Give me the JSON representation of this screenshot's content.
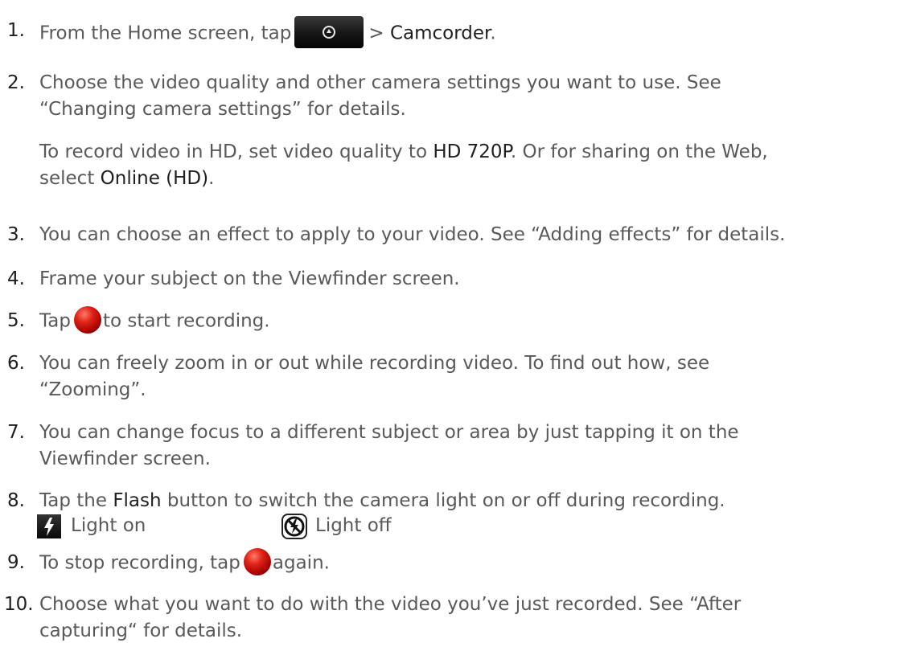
{
  "steps": [
    {
      "num": "1.",
      "parts": [
        "From the Home screen, tap",
        "> ",
        "Camcorder",
        "."
      ]
    },
    {
      "num": "2.",
      "lines": [
        "Choose the video quality and other camera settings you want to use. See",
        "“Changing camera settings” for details."
      ],
      "sub": [
        "To record video in HD, set video quality to ",
        "HD 720P",
        ". Or for sharing on the Web,",
        "select ",
        "Online (HD)",
        "."
      ]
    },
    {
      "num": "3.",
      "text": "You can choose an effect to apply to your video. See “Adding effects” for details."
    },
    {
      "num": "4.",
      "text": "Frame your subject on the Viewfinder screen."
    },
    {
      "num": "5.",
      "parts": [
        "Tap",
        "to start recording."
      ]
    },
    {
      "num": "6.",
      "lines": [
        "You can freely zoom in or out while recording video. To find out how, see",
        "“Zooming”."
      ]
    },
    {
      "num": "7.",
      "lines": [
        "You can change focus to a different subject or area by just tapping it on the",
        "Viewfinder screen."
      ]
    },
    {
      "num": "8.",
      "parts": [
        "Tap the ",
        "Flash",
        " button to switch the camera light on or off during recording."
      ]
    },
    {
      "num": "9.",
      "parts": [
        "To stop recording, tap",
        "again."
      ]
    },
    {
      "num": "10.",
      "lines": [
        "Choose what you want to do with the video you’ve just recorded. See “After",
        "capturing“ for details."
      ]
    }
  ],
  "flash": {
    "on_label": "Light on",
    "off_label": "Light off"
  },
  "icons": {
    "home_button": "all-apps-arrow-icon",
    "record": "record-button-icon",
    "flash_on": "flash-on-icon",
    "flash_off": "flash-off-icon"
  },
  "colors": {
    "text": "#595959",
    "emphasis": "#1f1f1f",
    "record_red": "#c81a10"
  }
}
